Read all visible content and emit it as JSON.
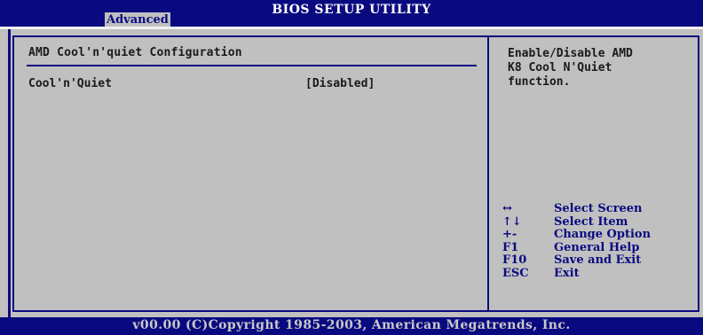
{
  "header": {
    "title": "BIOS SETUP UTILITY",
    "active_tab": "Advanced"
  },
  "main": {
    "section_title": "AMD Cool'n'quiet Configuration",
    "settings": [
      {
        "label": "Cool'n'Quiet",
        "value": "[Disabled]"
      }
    ]
  },
  "help": {
    "text": "Enable/Disable AMD\nK8 Cool N'Quiet\nfunction."
  },
  "keys": [
    {
      "glyph": "↔",
      "icon": "left-right-arrow-icon",
      "desc": "Select Screen"
    },
    {
      "glyph": "↑↓",
      "icon": "up-down-arrow-icon",
      "desc": "Select Item"
    },
    {
      "glyph": "+-",
      "icon": "plus-minus-icon",
      "desc": "Change Option"
    },
    {
      "glyph": "F1",
      "icon": "",
      "desc": "General Help"
    },
    {
      "glyph": "F10",
      "icon": "",
      "desc": "Save and Exit"
    },
    {
      "glyph": "ESC",
      "icon": "",
      "desc": "Exit"
    }
  ],
  "footer": {
    "copyright": "v00.00 (C)Copyright 1985-2003, American Megatrends, Inc."
  },
  "colors": {
    "bar_blue": "#0a0a80",
    "panel_gray": "#c0c0c0",
    "text_dark": "#1a1a1a",
    "footer_text": "#c8c8c8"
  }
}
